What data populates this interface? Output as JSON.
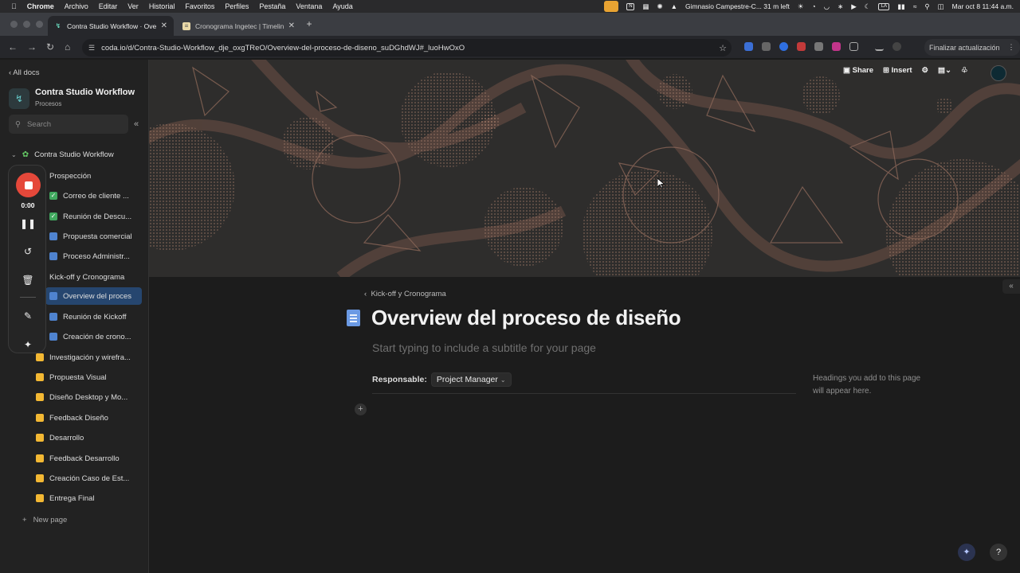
{
  "menubar": {
    "apple": "",
    "app": "Chrome",
    "items": [
      "Archivo",
      "Editar",
      "Ver",
      "Historial",
      "Favoritos",
      "Perfiles",
      "Pestaña",
      "Ventana",
      "Ayuda"
    ],
    "event": "Gimnasio Campestre-C...",
    "event_time": "31 m left",
    "input_source": "LA",
    "datetime": "Mar oct 8  11:44 a.m."
  },
  "tabs": [
    {
      "title": "Contra Studio Workflow · Overview",
      "active": true
    },
    {
      "title": "Cronograma Ingetec | Timeline",
      "active": false
    }
  ],
  "address": {
    "url": "coda.io/d/Contra-Studio-Workflow_dje_oxgTReO/Overview-del-proceso-de-diseno_suDGhdWJ#_luoHwOxO",
    "update_label": "Finalizar actualización"
  },
  "sidebar": {
    "all_docs": "All docs",
    "doc_title": "Contra Studio Workflow",
    "doc_subtitle": "Procesos",
    "search_placeholder": "Search",
    "root": "Contra Studio Workflow",
    "items": [
      {
        "label": "Prospección",
        "icon": "folder-icon"
      },
      {
        "label": "Correo de cliente ...",
        "icon": "checkbox-icon"
      },
      {
        "label": "Reunión de Descu...",
        "icon": "checkbox-icon"
      },
      {
        "label": "Propuesta comercial",
        "icon": "doc-icon"
      },
      {
        "label": "Proceso Administr...",
        "icon": "doc-icon"
      },
      {
        "label": "Kick-off y Cronograma",
        "icon": "folder-icon"
      },
      {
        "label": "Overview del proces",
        "icon": "doc-icon"
      },
      {
        "label": "Reunión de Kickoff",
        "icon": "doc-icon"
      },
      {
        "label": "Creación de crono...",
        "icon": "doc-icon"
      },
      {
        "label": "Investigación y wirefra...",
        "icon": "folder-icon"
      },
      {
        "label": "Propuesta Visual",
        "icon": "folder-icon"
      },
      {
        "label": "Diseño Desktop y Mo...",
        "icon": "folder-icon"
      },
      {
        "label": "Feedback Diseño",
        "icon": "folder-icon"
      },
      {
        "label": "Desarrollo",
        "icon": "folder-icon"
      },
      {
        "label": "Feedback Desarrollo",
        "icon": "folder-icon"
      },
      {
        "label": "Creación Caso de Est...",
        "icon": "folder-icon"
      },
      {
        "label": "Entrega Final",
        "icon": "folder-icon"
      }
    ],
    "new_page": "New page"
  },
  "recorder": {
    "time": "0:00"
  },
  "toolbar": {
    "share": "Share",
    "insert": "Insert"
  },
  "page": {
    "breadcrumb": "Kick-off y Cronograma",
    "title": "Overview del proceso de diseño",
    "subtitle_placeholder": "Start typing to include a subtitle for your page",
    "responsable_label": "Responsable:",
    "responsable_value": "Project Manager",
    "outline_hint": "Headings you add to this page will appear here."
  },
  "colors": {
    "accent": "#26466f",
    "record": "#e5483a",
    "folder": "#f3b833",
    "doc": "#4f83cf",
    "check": "#41a85f"
  }
}
